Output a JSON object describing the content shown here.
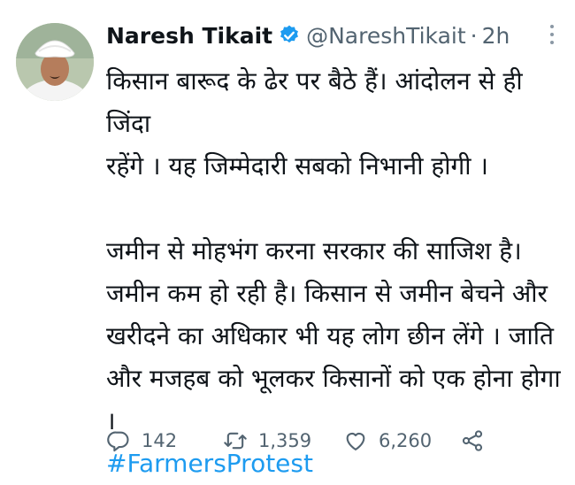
{
  "tweet": {
    "author": {
      "display_name": "Naresh Tikait",
      "handle": "@NareshTikait",
      "verified": true
    },
    "separator": "·",
    "time": "2h",
    "paragraphs": [
      [
        "किसान बारूद के ढेर पर बैठे हैं। आंदोलन से ही जिंदा",
        "रहेंगे । यह जिम्मेदारी सबको निभानी होगी ।"
      ],
      [
        "जमीन से मोहभंग करना सरकार की साजिश है।",
        "जमीन कम हो रही है। किसान से जमीन बेचने और",
        "खरीदने का अधिकार भी यह लोग छीन लेंगे । जाति",
        "और मजहब को भूलकर किसानों को एक होना होगा ।"
      ]
    ],
    "hashtag": "#FarmersProtest",
    "metrics": {
      "replies": "142",
      "retweets": "1,359",
      "likes": "6,260"
    }
  },
  "colors": {
    "text": "#0f1419",
    "secondary": "#536471",
    "link": "#1d9bf0",
    "verified_badge": "#1d9bf0"
  },
  "icons": [
    "avatar",
    "verified-icon",
    "more-options-icon",
    "reply-icon",
    "retweet-icon",
    "like-icon",
    "share-icon"
  ]
}
